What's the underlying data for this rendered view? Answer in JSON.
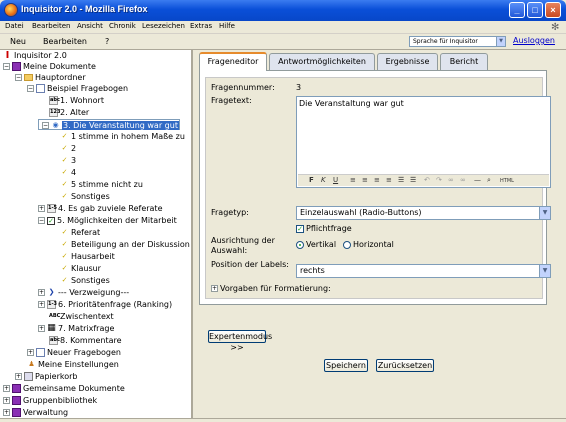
{
  "window": {
    "title": "Inquisitor 2.0 - Mozilla Firefox"
  },
  "menubar": [
    "Datei",
    "Bearbeiten",
    "Ansicht",
    "Chronik",
    "Lesezeichen",
    "Extras",
    "Hilfe"
  ],
  "app_toolbar": {
    "new": "Neu",
    "edit": "Bearbeiten",
    "help": "?",
    "language": "Sprache für Inquisitor",
    "logout": "Ausloggen"
  },
  "tree": [
    "Inquisitor 2.0",
    "Meine Dokumente",
    "Hauptordner",
    "Beispiel Fragebogen",
    "1. Wohnort",
    "2. Alter",
    "3. Die Veranstaltung war gut",
    "1 stimme in hohem Maße zu",
    "2",
    "3",
    "4",
    "5 stimme nicht zu",
    "Sonstiges",
    "4. Es gab zuviele Referate",
    "5. Möglichkeiten der Mitarbeit",
    "Referat",
    "Beteiligung an der Diskussion",
    "Hausarbeit",
    "Klausur",
    "Sonstiges",
    "--- Verzweigung---",
    "6. Prioritätenfrage (Ranking)",
    "Zwischentext",
    "7. Matrixfrage",
    "8. Kommentare",
    "Neuer Fragebogen",
    "Meine Einstellungen",
    "Papierkorb",
    "Gemeinsame Dokumente",
    "Gruppenbibliothek",
    "Verwaltung"
  ],
  "tabs": [
    "Frageneditor",
    "Antwortmöglichkeiten",
    "Ergebnisse",
    "Bericht"
  ],
  "editor": {
    "number_label": "Fragennummer:",
    "number_value": "3",
    "text_label": "Fragetext:",
    "text_value": "Die Veranstaltung war gut",
    "type_label": "Fragetyp:",
    "type_value": "Einzelauswahl (Radio-Buttons)",
    "required_label": "Pflichtfrage",
    "orientation_label": "Ausrichtung der Auswahl:",
    "vertical": "Vertikal",
    "horizontal": "Horizontal",
    "position_label": "Position der Labels:",
    "position_value": "rechts",
    "formatting": "Vorgaben für Formatierung:",
    "expert": "Expertenmodus >>"
  },
  "actions": {
    "save": "Speichern",
    "reset": "Zurücksetzen"
  },
  "rte_toolbar": [
    "F",
    "K",
    "U",
    "≡",
    "≡",
    "≡",
    "≡",
    "☰",
    "☰",
    "↶",
    "↷",
    "∞",
    "∞",
    "—",
    "⌕",
    "HTML"
  ]
}
